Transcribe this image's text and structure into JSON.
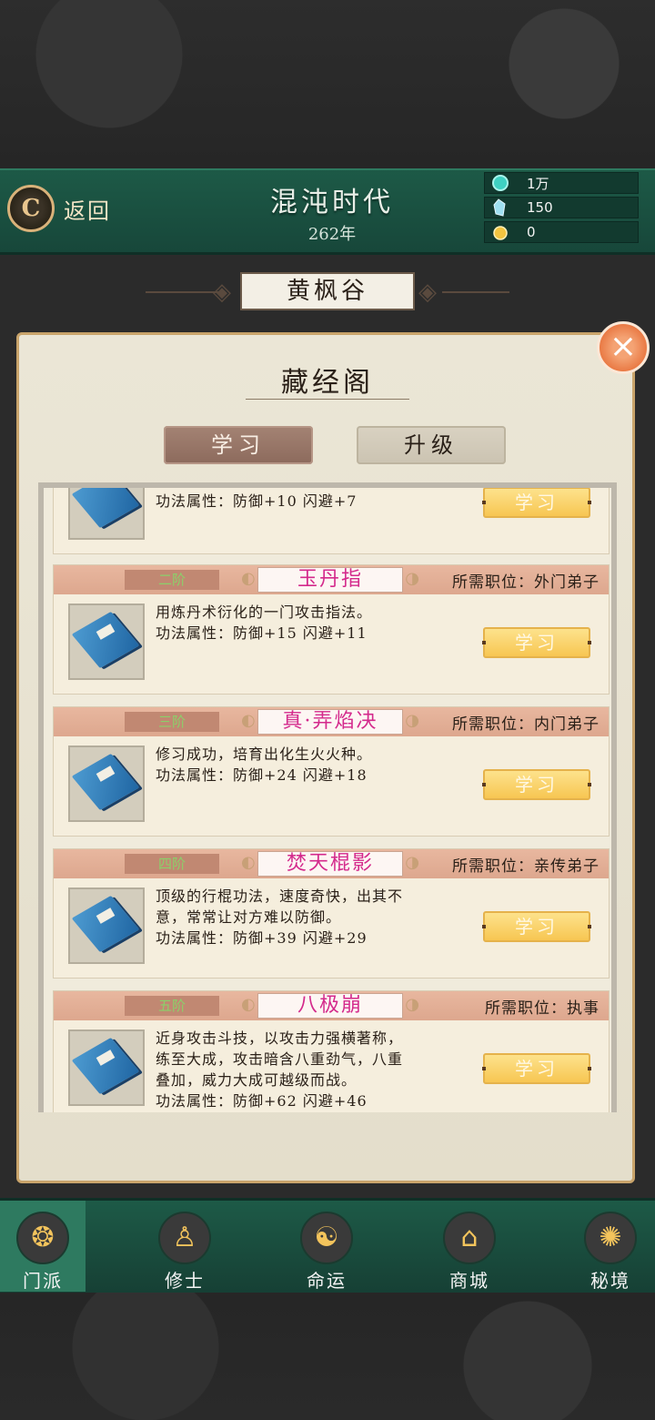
{
  "header": {
    "back_label": "返回",
    "era_title": "混沌时代",
    "era_year": "262年",
    "resources": [
      {
        "icon": "jade-orb-icon",
        "value": "1万",
        "color": "#3fd1c2"
      },
      {
        "icon": "spirit-stone-icon",
        "value": "150",
        "color": "#9fdff0"
      },
      {
        "icon": "gold-coin-icon",
        "value": "0",
        "color": "#f2c440"
      }
    ]
  },
  "sect_name": "黄枫谷",
  "panel": {
    "title": "藏经阁",
    "close_icon": "×",
    "tabs": [
      {
        "label": "学习",
        "active": true
      },
      {
        "label": "升级",
        "active": false
      }
    ]
  },
  "partial_card": {
    "desc": "功法属性：防御+10 闪避+7",
    "button": "学习"
  },
  "skills": [
    {
      "rank": "二阶",
      "name": "玉丹指",
      "requirement": "所需职位：外门弟子",
      "desc": [
        "用炼丹术衍化的一门攻击指法。",
        "功法属性：防御+15 闪避+11"
      ],
      "button": "学习"
    },
    {
      "rank": "三阶",
      "name": "真·弄焰决",
      "requirement": "所需职位：内门弟子",
      "desc": [
        "修习成功，培育出化生火火种。",
        "功法属性：防御+24 闪避+18"
      ],
      "button": "学习"
    },
    {
      "rank": "四阶",
      "name": "焚天棍影",
      "requirement": "所需职位：亲传弟子",
      "desc": [
        "顶级的行棍功法，速度奇快，出其不",
        "意，常常让对方难以防御。",
        "功法属性：防御+39 闪避+29"
      ],
      "button": "学习"
    },
    {
      "rank": "五阶",
      "name": "八极崩",
      "requirement": "所需职位：执事",
      "desc": [
        "近身攻击斗技，以攻击力强横著称，",
        "练至大成，攻击暗含八重劲气，八重",
        "叠加，威力大成可越级而战。",
        "功法属性：防御+62 闪避+46"
      ],
      "button": "学习"
    }
  ],
  "nav": [
    {
      "label": "门派",
      "icon": "sect-emblem-icon",
      "active": true
    },
    {
      "label": "修士",
      "icon": "meditating-cultivator-icon",
      "active": false
    },
    {
      "label": "命运",
      "icon": "gourd-fate-icon",
      "active": false
    },
    {
      "label": "商城",
      "icon": "shop-stall-icon",
      "active": false
    },
    {
      "label": "秘境",
      "icon": "dragon-realm-icon",
      "active": false
    }
  ]
}
